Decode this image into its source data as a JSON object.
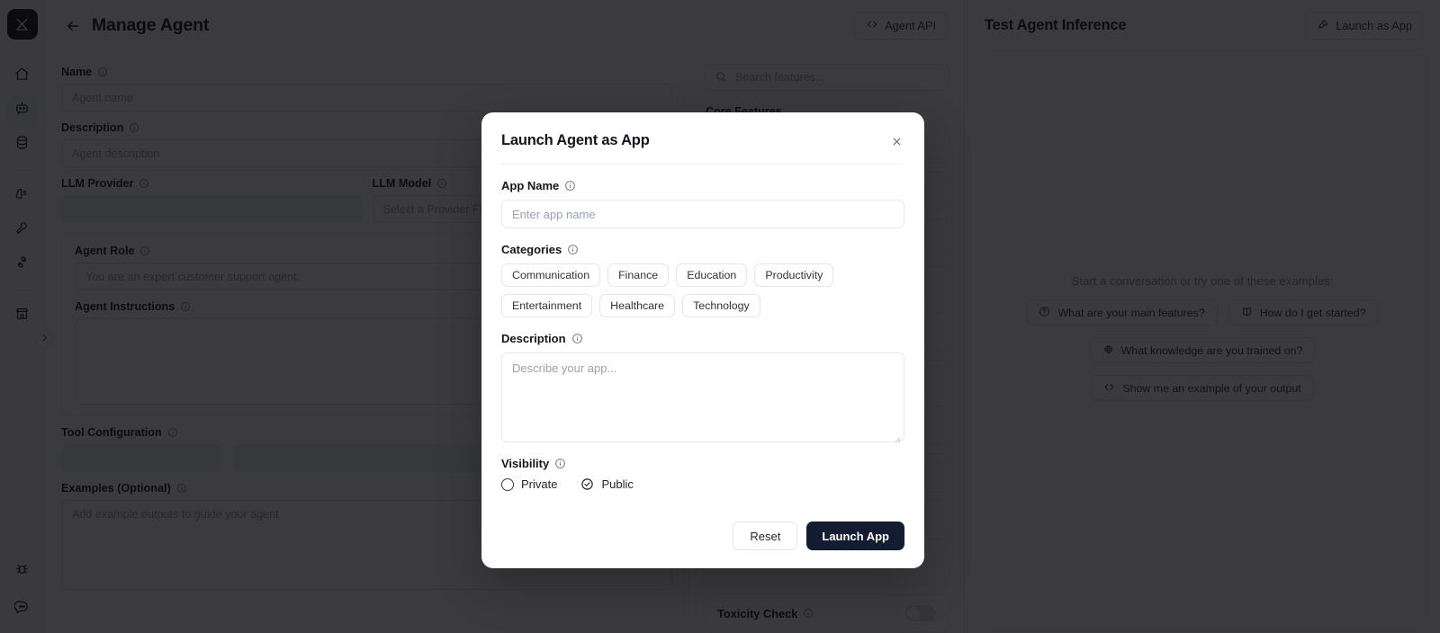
{
  "sidebar": {
    "logo_icon": "app-logo-icon",
    "items": [
      {
        "icon": "home-icon",
        "name": "home",
        "active": false
      },
      {
        "icon": "robot-icon",
        "name": "agents",
        "active": true
      },
      {
        "icon": "database-icon",
        "name": "data",
        "active": false
      },
      {
        "icon": "brain-icon",
        "name": "models",
        "active": false
      },
      {
        "icon": "wrench-icon",
        "name": "tools",
        "active": false
      },
      {
        "icon": "plug-icon",
        "name": "integrations",
        "active": false
      },
      {
        "icon": "store-icon",
        "name": "marketplace",
        "active": false
      }
    ],
    "bottom_items": [
      {
        "icon": "bug-icon",
        "name": "report-bug"
      },
      {
        "icon": "chat-bubble-icon",
        "name": "support-chat"
      }
    ],
    "expand_icon": "chevron-right-icon"
  },
  "topbar": {
    "back_icon": "arrow-left-icon",
    "title": "Manage Agent",
    "agent_api_label": "Agent API",
    "agent_api_icon": "code-brackets-icon"
  },
  "form": {
    "name": {
      "label": "Name",
      "placeholder": "Agent name",
      "value": ""
    },
    "description": {
      "label": "Description",
      "placeholder": "Agent description",
      "value": ""
    },
    "llm_provider": {
      "label": "LLM Provider",
      "value": ""
    },
    "llm_model": {
      "label": "LLM Model",
      "placeholder": "Select a Provider First",
      "value": ""
    },
    "agent_role": {
      "label": "Agent Role",
      "placeholder": "You are an expert customer support agent.",
      "value": ""
    },
    "agent_instructions": {
      "label": "Agent Instructions",
      "placeholder": "",
      "value": ""
    },
    "tool_configuration": {
      "label": "Tool Configuration"
    },
    "examples": {
      "label": "Examples (Optional)",
      "placeholder": "Add example outputs to guide your agent",
      "value": ""
    },
    "info_icon": "info-icon"
  },
  "features": {
    "search_placeholder": "Search features...",
    "search_icon": "search-icon",
    "heading": "Core Features",
    "toxicity": {
      "label": "Toxicity Check",
      "enabled": false,
      "info_icon": "info-icon"
    }
  },
  "inference": {
    "title": "Test Agent Inference",
    "launch_label": "Launch as App",
    "launch_icon": "rocket-icon",
    "hint": "Start a conversation or try one of these examples:",
    "examples": [
      {
        "icon": "question-circle-icon",
        "label": "What are your main features?"
      },
      {
        "icon": "book-icon",
        "label": "How do I get started?"
      },
      {
        "icon": "chip-icon",
        "label": "What knowledge are you trained on?"
      },
      {
        "icon": "code-brackets-icon",
        "label": "Show me an example of your output"
      }
    ]
  },
  "modal": {
    "title": "Launch Agent as App",
    "close_icon": "close-icon",
    "info_icon": "info-icon",
    "app_name": {
      "label": "App Name",
      "placeholder": "Enter app name",
      "value": ""
    },
    "categories": {
      "label": "Categories",
      "options": [
        "Communication",
        "Finance",
        "Education",
        "Productivity",
        "Entertainment",
        "Healthcare",
        "Technology"
      ],
      "selected": []
    },
    "description": {
      "label": "Description",
      "placeholder": "Describe your app...",
      "value": ""
    },
    "visibility": {
      "label": "Visibility",
      "options": [
        {
          "label": "Private",
          "selected": false
        },
        {
          "label": "Public",
          "selected": true
        }
      ]
    },
    "reset_label": "Reset",
    "launch_label": "Launch App",
    "accent_color": "#141c32"
  }
}
